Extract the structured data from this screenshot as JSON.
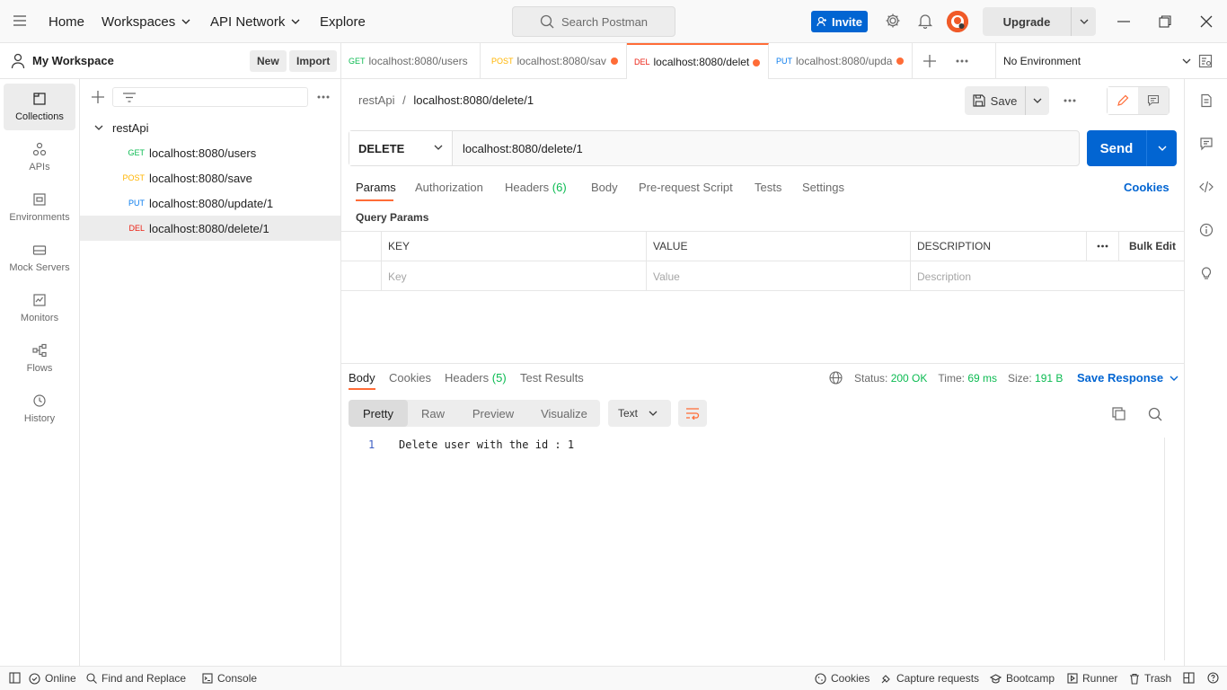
{
  "topbar": {
    "nav": [
      "Home",
      "Workspaces",
      "API Network",
      "Explore"
    ],
    "search_placeholder": "Search Postman",
    "invite_label": "Invite",
    "upgrade_label": "Upgrade"
  },
  "workspace": {
    "title": "My Workspace",
    "new_label": "New",
    "import_label": "Import"
  },
  "rail": {
    "items": [
      "Collections",
      "APIs",
      "Environments",
      "Mock Servers",
      "Monitors",
      "Flows",
      "History"
    ]
  },
  "sidebar": {
    "collection": "restApi",
    "requests": [
      {
        "method": "GET",
        "name": "localhost:8080/users",
        "color": "#0cbb52"
      },
      {
        "method": "POST",
        "name": "localhost:8080/save",
        "color": "#ffb400"
      },
      {
        "method": "PUT",
        "name": "localhost:8080/update/1",
        "color": "#097bed"
      },
      {
        "method": "DEL",
        "name": "localhost:8080/delete/1",
        "color": "#eb2013"
      }
    ]
  },
  "tabs": [
    {
      "method": "GET",
      "label": "localhost:8080/users"
    },
    {
      "method": "POST",
      "label": "localhost:8080/sav"
    },
    {
      "method": "DEL",
      "label": "localhost:8080/delet"
    },
    {
      "method": "PUT",
      "label": "localhost:8080/upda"
    }
  ],
  "environment": "No Environment",
  "request": {
    "breadcrumb_parent": "restApi",
    "breadcrumb_sep": "/",
    "breadcrumb_current": "localhost:8080/delete/1",
    "save_label": "Save",
    "method": "DELETE",
    "url": "localhost:8080/delete/1",
    "send_label": "Send",
    "tabs": {
      "params": "Params",
      "authorization": "Authorization",
      "headers": "Headers",
      "headers_count": "(6)",
      "body": "Body",
      "prerequest": "Pre-request Script",
      "tests": "Tests",
      "settings": "Settings"
    },
    "cookies_label": "Cookies",
    "query_params_title": "Query Params",
    "table": {
      "col_key": "KEY",
      "col_value": "VALUE",
      "col_description": "DESCRIPTION",
      "bulk_edit": "Bulk Edit",
      "ph_key": "Key",
      "ph_value": "Value",
      "ph_description": "Description"
    }
  },
  "response": {
    "tabs": {
      "body": "Body",
      "cookies": "Cookies",
      "headers": "Headers",
      "headers_count": "(5)",
      "test_results": "Test Results"
    },
    "status_label": "Status:",
    "status_value": "200 OK",
    "time_label": "Time:",
    "time_value": "69 ms",
    "size_label": "Size:",
    "size_value": "191 B",
    "save_response": "Save Response",
    "formats": [
      "Pretty",
      "Raw",
      "Preview",
      "Visualize"
    ],
    "text_type": "Text",
    "line_number": "1",
    "body_text": "Delete user with the id : 1"
  },
  "footer": {
    "online": "Online",
    "find_replace": "Find and Replace",
    "console": "Console",
    "cookies": "Cookies",
    "capture": "Capture requests",
    "bootcamp": "Bootcamp",
    "runner": "Runner",
    "trash": "Trash"
  }
}
